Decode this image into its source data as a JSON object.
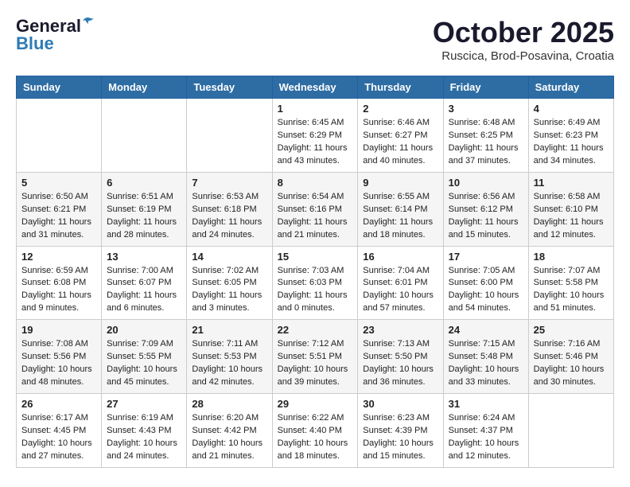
{
  "header": {
    "logo_line1": "General",
    "logo_line2": "Blue",
    "month": "October 2025",
    "location": "Ruscica, Brod-Posavina, Croatia"
  },
  "weekdays": [
    "Sunday",
    "Monday",
    "Tuesday",
    "Wednesday",
    "Thursday",
    "Friday",
    "Saturday"
  ],
  "weeks": [
    [
      {
        "day": "",
        "info": ""
      },
      {
        "day": "",
        "info": ""
      },
      {
        "day": "",
        "info": ""
      },
      {
        "day": "1",
        "info": "Sunrise: 6:45 AM\nSunset: 6:29 PM\nDaylight: 11 hours\nand 43 minutes."
      },
      {
        "day": "2",
        "info": "Sunrise: 6:46 AM\nSunset: 6:27 PM\nDaylight: 11 hours\nand 40 minutes."
      },
      {
        "day": "3",
        "info": "Sunrise: 6:48 AM\nSunset: 6:25 PM\nDaylight: 11 hours\nand 37 minutes."
      },
      {
        "day": "4",
        "info": "Sunrise: 6:49 AM\nSunset: 6:23 PM\nDaylight: 11 hours\nand 34 minutes."
      }
    ],
    [
      {
        "day": "5",
        "info": "Sunrise: 6:50 AM\nSunset: 6:21 PM\nDaylight: 11 hours\nand 31 minutes."
      },
      {
        "day": "6",
        "info": "Sunrise: 6:51 AM\nSunset: 6:19 PM\nDaylight: 11 hours\nand 28 minutes."
      },
      {
        "day": "7",
        "info": "Sunrise: 6:53 AM\nSunset: 6:18 PM\nDaylight: 11 hours\nand 24 minutes."
      },
      {
        "day": "8",
        "info": "Sunrise: 6:54 AM\nSunset: 6:16 PM\nDaylight: 11 hours\nand 21 minutes."
      },
      {
        "day": "9",
        "info": "Sunrise: 6:55 AM\nSunset: 6:14 PM\nDaylight: 11 hours\nand 18 minutes."
      },
      {
        "day": "10",
        "info": "Sunrise: 6:56 AM\nSunset: 6:12 PM\nDaylight: 11 hours\nand 15 minutes."
      },
      {
        "day": "11",
        "info": "Sunrise: 6:58 AM\nSunset: 6:10 PM\nDaylight: 11 hours\nand 12 minutes."
      }
    ],
    [
      {
        "day": "12",
        "info": "Sunrise: 6:59 AM\nSunset: 6:08 PM\nDaylight: 11 hours\nand 9 minutes."
      },
      {
        "day": "13",
        "info": "Sunrise: 7:00 AM\nSunset: 6:07 PM\nDaylight: 11 hours\nand 6 minutes."
      },
      {
        "day": "14",
        "info": "Sunrise: 7:02 AM\nSunset: 6:05 PM\nDaylight: 11 hours\nand 3 minutes."
      },
      {
        "day": "15",
        "info": "Sunrise: 7:03 AM\nSunset: 6:03 PM\nDaylight: 11 hours\nand 0 minutes."
      },
      {
        "day": "16",
        "info": "Sunrise: 7:04 AM\nSunset: 6:01 PM\nDaylight: 10 hours\nand 57 minutes."
      },
      {
        "day": "17",
        "info": "Sunrise: 7:05 AM\nSunset: 6:00 PM\nDaylight: 10 hours\nand 54 minutes."
      },
      {
        "day": "18",
        "info": "Sunrise: 7:07 AM\nSunset: 5:58 PM\nDaylight: 10 hours\nand 51 minutes."
      }
    ],
    [
      {
        "day": "19",
        "info": "Sunrise: 7:08 AM\nSunset: 5:56 PM\nDaylight: 10 hours\nand 48 minutes."
      },
      {
        "day": "20",
        "info": "Sunrise: 7:09 AM\nSunset: 5:55 PM\nDaylight: 10 hours\nand 45 minutes."
      },
      {
        "day": "21",
        "info": "Sunrise: 7:11 AM\nSunset: 5:53 PM\nDaylight: 10 hours\nand 42 minutes."
      },
      {
        "day": "22",
        "info": "Sunrise: 7:12 AM\nSunset: 5:51 PM\nDaylight: 10 hours\nand 39 minutes."
      },
      {
        "day": "23",
        "info": "Sunrise: 7:13 AM\nSunset: 5:50 PM\nDaylight: 10 hours\nand 36 minutes."
      },
      {
        "day": "24",
        "info": "Sunrise: 7:15 AM\nSunset: 5:48 PM\nDaylight: 10 hours\nand 33 minutes."
      },
      {
        "day": "25",
        "info": "Sunrise: 7:16 AM\nSunset: 5:46 PM\nDaylight: 10 hours\nand 30 minutes."
      }
    ],
    [
      {
        "day": "26",
        "info": "Sunrise: 6:17 AM\nSunset: 4:45 PM\nDaylight: 10 hours\nand 27 minutes."
      },
      {
        "day": "27",
        "info": "Sunrise: 6:19 AM\nSunset: 4:43 PM\nDaylight: 10 hours\nand 24 minutes."
      },
      {
        "day": "28",
        "info": "Sunrise: 6:20 AM\nSunset: 4:42 PM\nDaylight: 10 hours\nand 21 minutes."
      },
      {
        "day": "29",
        "info": "Sunrise: 6:22 AM\nSunset: 4:40 PM\nDaylight: 10 hours\nand 18 minutes."
      },
      {
        "day": "30",
        "info": "Sunrise: 6:23 AM\nSunset: 4:39 PM\nDaylight: 10 hours\nand 15 minutes."
      },
      {
        "day": "31",
        "info": "Sunrise: 6:24 AM\nSunset: 4:37 PM\nDaylight: 10 hours\nand 12 minutes."
      },
      {
        "day": "",
        "info": ""
      }
    ]
  ]
}
